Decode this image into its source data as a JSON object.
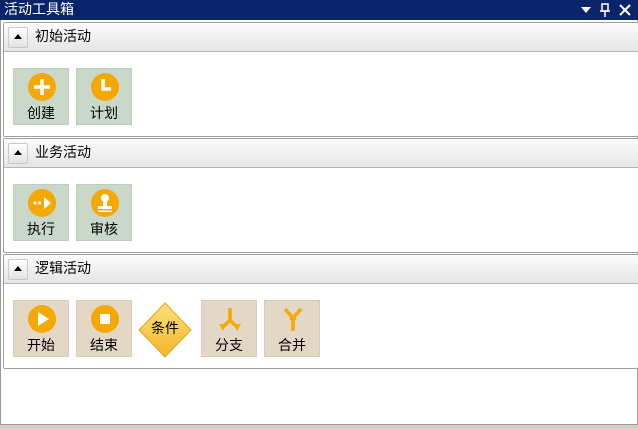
{
  "window": {
    "title": "活动工具箱",
    "dropdown_icon": "dropdown-arrow-icon",
    "pin_icon": "pin-icon",
    "close_icon": "close-icon",
    "title_bg": "#0a246a"
  },
  "sections": [
    {
      "title": "初始活动",
      "items": [
        {
          "label": "创建",
          "icon": "plus-icon"
        },
        {
          "label": "计划",
          "icon": "clock-icon"
        }
      ]
    },
    {
      "title": "业务活动",
      "items": [
        {
          "label": "执行",
          "icon": "arrow-right-icon"
        },
        {
          "label": "审核",
          "icon": "stamp-icon"
        }
      ]
    },
    {
      "title": "逻辑活动",
      "items": [
        {
          "label": "开始",
          "icon": "play-icon"
        },
        {
          "label": "结束",
          "icon": "stop-icon"
        },
        {
          "label": "条件",
          "icon": "diamond-icon"
        },
        {
          "label": "分支",
          "icon": "fork-icon"
        },
        {
          "label": "合并",
          "icon": "merge-icon"
        }
      ]
    }
  ],
  "colors": {
    "accent_orange": "#f5a800",
    "tile_green": "#c9d8c8",
    "tile_tan": "#e3d8c6",
    "diamond_fill": "#fbc944"
  }
}
